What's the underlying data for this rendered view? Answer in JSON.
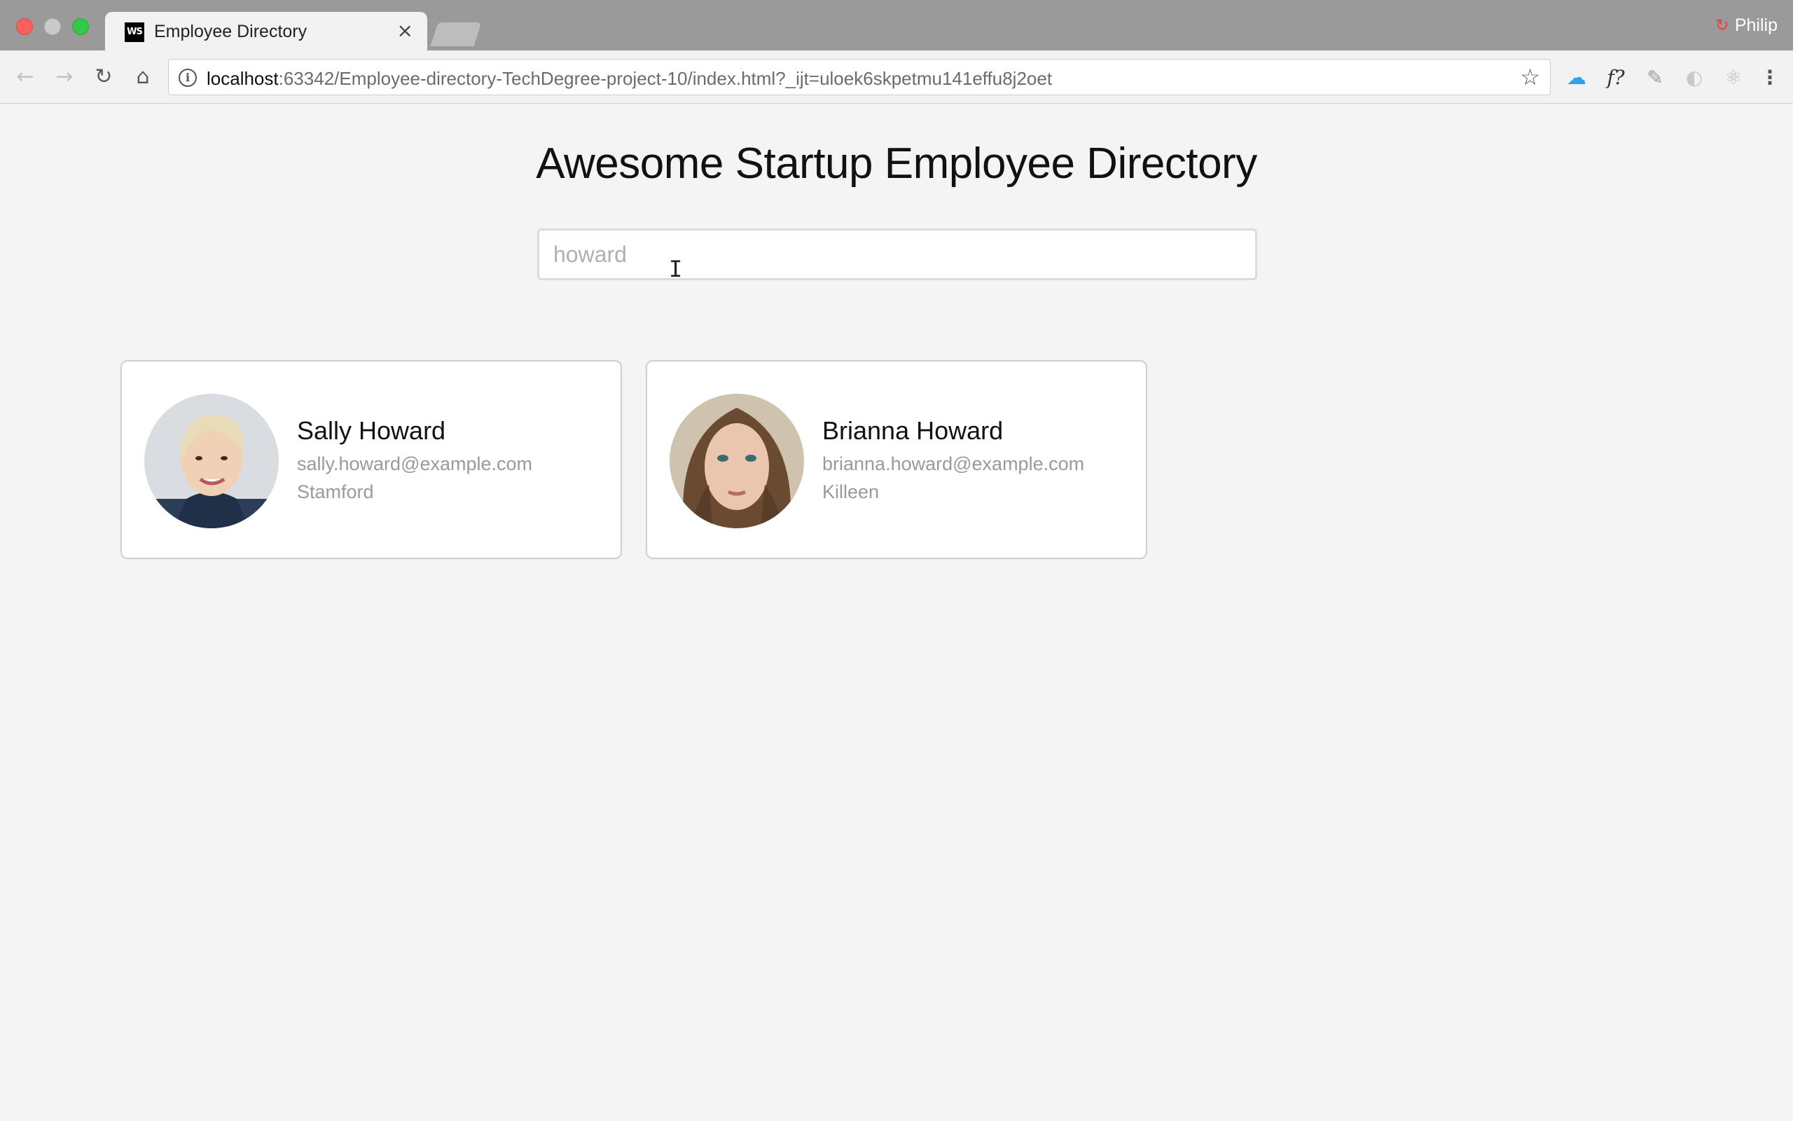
{
  "browser": {
    "tab_title": "Employee Directory",
    "tab_favicon_text": "WS",
    "tab_close": "×",
    "profile_name": "Philip",
    "url_host": "localhost",
    "url_rest": ":63342/Employee-directory-TechDegree-project-10/index.html?_ijt=uloek6skpetmu141effu8j2oet",
    "extension_fx_label": "f?"
  },
  "page": {
    "title": "Awesome Startup Employee Directory",
    "search": {
      "value": "",
      "placeholder": "howard"
    }
  },
  "employees": [
    {
      "name": "Sally Howard",
      "email": "sally.howard@example.com",
      "city": "Stamford"
    },
    {
      "name": "Brianna Howard",
      "email": "brianna.howard@example.com",
      "city": "Killeen"
    }
  ],
  "colors": {
    "chrome_titlebar": "#9a9a9a",
    "page_background": "#f4f4f4",
    "card_border": "#cfcfcf",
    "secondary_text": "#9a9a9a"
  }
}
